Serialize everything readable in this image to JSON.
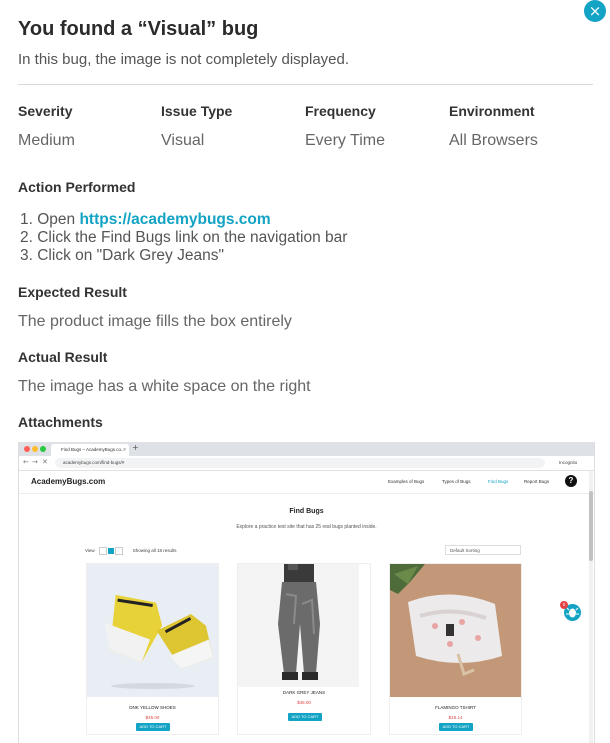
{
  "modal": {
    "close_glyph": "×",
    "title": "You found a “Visual” bug",
    "subtitle": "In this bug, the image is not completely displayed."
  },
  "meta": [
    {
      "label": "Severity",
      "value": "Medium"
    },
    {
      "label": "Issue Type",
      "value": "Visual"
    },
    {
      "label": "Frequency",
      "value": "Every Time"
    },
    {
      "label": "Environment",
      "value": "All Browsers"
    }
  ],
  "action": {
    "label": "Action Performed",
    "steps": [
      {
        "prefix": "1. Open ",
        "link": "https://academybugs.com"
      },
      {
        "text": "2. Click the Find Bugs link on the navigation bar"
      },
      {
        "text": "3. Click on \"Dark Grey Jeans\""
      }
    ]
  },
  "expected": {
    "label": "Expected Result",
    "text": "The product image fills the box entirely"
  },
  "actual": {
    "label": "Actual Result",
    "text": "The image has a white space on the right"
  },
  "attachments": {
    "label": "Attachments",
    "browser": {
      "tab_title": "Find Bugs – AcademyBugs.co...",
      "tab_close": "×",
      "new_tab": "+",
      "url": "academybugs.com/find-bugs/#",
      "incognito": "Incognito"
    },
    "site": {
      "logo": "AcademyBugs.com",
      "nav": [
        "Examples of Bugs",
        "Types of Bugs",
        "Find Bugs",
        "Report Bugs"
      ],
      "help": "?",
      "heading": "Find Bugs",
      "subheading": "Explore a practice test site that has 25 real bugs planted inside.",
      "view_label": "View",
      "results": "Showing all 18 results",
      "sorting": "Default Sorting",
      "bug_count": "0"
    },
    "products": [
      {
        "name": "DNK YELLOW SHOES",
        "price": "$45.00",
        "button": "ADD TO CART"
      },
      {
        "name": "DARK GREY JEANS",
        "price": "$48.00",
        "button": "ADD TO CART"
      },
      {
        "name": "FLAMINGO TSHIRT",
        "price": "$19.14",
        "button": "ADD TO CART"
      }
    ]
  },
  "colors": {
    "accent": "#13a3c4",
    "price": "#e04444"
  }
}
